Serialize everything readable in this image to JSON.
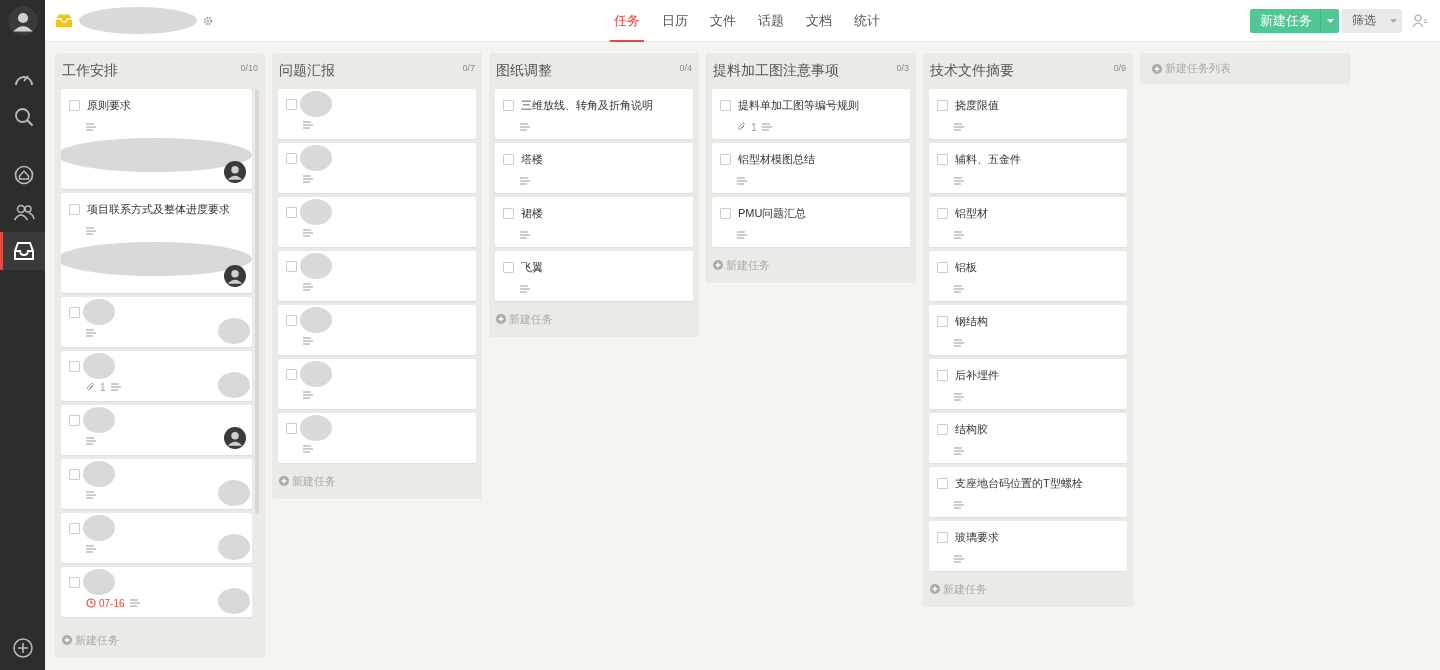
{
  "sidebar": {
    "items": [
      {
        "selected": false
      },
      {
        "selected": false
      },
      {
        "selected": false
      },
      {
        "selected": false
      },
      {
        "selected": true
      }
    ]
  },
  "header": {
    "project_name_redacted": true,
    "tabs": [
      {
        "label": "任务",
        "selected": true
      },
      {
        "label": "日历",
        "selected": false
      },
      {
        "label": "文件",
        "selected": false
      },
      {
        "label": "话题",
        "selected": false
      },
      {
        "label": "文档",
        "selected": false
      },
      {
        "label": "统计",
        "selected": false
      }
    ],
    "new_task_button": "新建任务",
    "filter_button": "筛选"
  },
  "columns": [
    {
      "title": "工作安排",
      "count": "0/10",
      "scrollable": true,
      "add_label": "新建任务",
      "cards": [
        {
          "title": "原则要求",
          "checked": false,
          "note": true,
          "members_redacted": true,
          "assignee_avatar": true
        },
        {
          "title": "项目联系方式及整体进度要求",
          "checked": false,
          "note": true,
          "members_redacted": true,
          "assignee_avatar": true
        },
        {
          "title_redacted": true,
          "checked": false,
          "note": true,
          "assignee_redacted": true
        },
        {
          "title_redacted": true,
          "checked": false,
          "attachments": "1",
          "note": true,
          "assignee_redacted": true
        },
        {
          "title_redacted": true,
          "checked": false,
          "note": true,
          "assignee_avatar": true
        },
        {
          "title_redacted": true,
          "checked": false,
          "note": true,
          "assignee_redacted": true
        },
        {
          "title_redacted": true,
          "checked": false,
          "note": true,
          "assignee_redacted": true
        },
        {
          "title_redacted": true,
          "checked": false,
          "due": "07-16",
          "note": true,
          "assignee_redacted": true
        }
      ]
    },
    {
      "title": "问题汇报",
      "count": "0/7",
      "add_label": "新建任务",
      "cards": [
        {
          "title_redacted": true,
          "checked": false,
          "note": true
        },
        {
          "title_redacted": true,
          "checked": false,
          "note": true
        },
        {
          "title_redacted": true,
          "checked": false,
          "note": true
        },
        {
          "title_redacted": true,
          "checked": false,
          "note": true
        },
        {
          "title_redacted": true,
          "checked": false,
          "note": true
        },
        {
          "title_redacted": true,
          "checked": false,
          "note": true
        },
        {
          "title_redacted": true,
          "checked": false,
          "note": true
        }
      ]
    },
    {
      "title": "图纸调整",
      "count": "0/4",
      "add_label": "新建任务",
      "cards": [
        {
          "title": "三维放线、转角及折角说明",
          "checked": false,
          "note": true
        },
        {
          "title": "塔楼",
          "checked": false,
          "note": true
        },
        {
          "title": "裙楼",
          "checked": false,
          "note": true
        },
        {
          "title": "飞翼",
          "checked": false,
          "note": true
        }
      ]
    },
    {
      "title": "提料加工图注意事项",
      "count": "0/3",
      "add_label": "新建任务",
      "cards": [
        {
          "title": "提料单加工图等编号规则",
          "checked": false,
          "attachments": "1",
          "note": true
        },
        {
          "title": "铝型材模图总结",
          "checked": false,
          "note": true
        },
        {
          "title": "PMU问题汇总",
          "checked": false,
          "note": true
        }
      ]
    },
    {
      "title": "技术文件摘要",
      "count": "0/9",
      "add_label": "新建任务",
      "cards": [
        {
          "title": "挠度限值",
          "checked": false,
          "note": true
        },
        {
          "title": "辅料、五金件",
          "checked": false,
          "note": true
        },
        {
          "title": "铝型材",
          "checked": false,
          "note": true
        },
        {
          "title": "铝板",
          "checked": false,
          "note": true
        },
        {
          "title": "钢结构",
          "checked": false,
          "note": true
        },
        {
          "title": "后补埋件",
          "checked": false,
          "note": true
        },
        {
          "title": "结构胶",
          "checked": false,
          "note": true
        },
        {
          "title": "支座地台码位置的T型螺栓",
          "checked": false,
          "note": true
        },
        {
          "title": "玻璃要求",
          "checked": false,
          "note": true
        }
      ]
    }
  ],
  "new_list_label": "新建任务列表"
}
